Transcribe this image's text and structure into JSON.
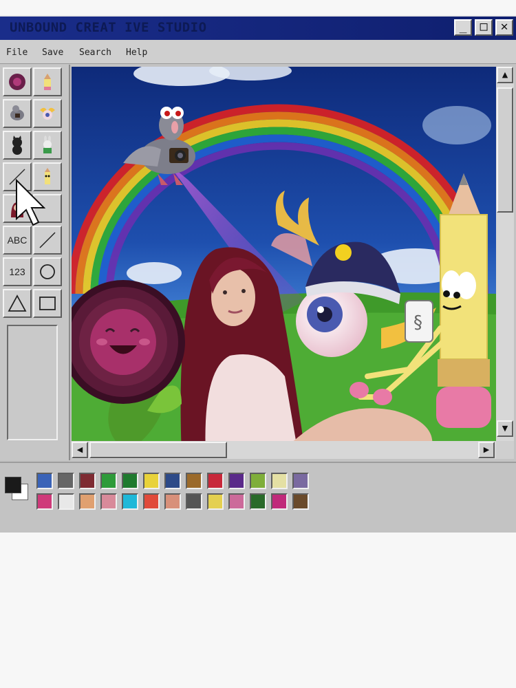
{
  "window": {
    "title": "UNBOUND CREAT IVE STUDIO",
    "controls": {
      "minimize": "_",
      "maximize": "□",
      "close": "✕"
    }
  },
  "menu": [
    "File",
    "Save",
    "Search",
    "Help"
  ],
  "tools": [
    {
      "name": "flower-stamp-tool",
      "label": "",
      "icon": "flower-icon"
    },
    {
      "name": "pencil-stamp-tool",
      "label": "",
      "icon": "pencil-icon"
    },
    {
      "name": "pigeon-camera-tool",
      "label": "",
      "icon": "pigeon-icon"
    },
    {
      "name": "winged-eye-tool",
      "label": "",
      "icon": "winged-eye-icon"
    },
    {
      "name": "black-cat-tool",
      "label": "",
      "icon": "cat-icon"
    },
    {
      "name": "bunny-tool",
      "label": "",
      "icon": "bunny-icon"
    },
    {
      "name": "line-tool",
      "label": "",
      "icon": "line-icon"
    },
    {
      "name": "pencil-character-tool",
      "label": "",
      "icon": "pencil-character-icon"
    },
    {
      "name": "girl-stamp-tool",
      "label": "",
      "icon": "portrait-icon"
    },
    {
      "name": "empty-tool",
      "label": "",
      "icon": ""
    },
    {
      "name": "text-tool",
      "label": "ABC",
      "icon": "text-icon"
    },
    {
      "name": "diagonal-line-tool",
      "label": "",
      "icon": "line-icon"
    },
    {
      "name": "number-tool",
      "label": "123",
      "icon": "number-icon"
    },
    {
      "name": "circle-tool",
      "label": "",
      "icon": "circle-icon"
    },
    {
      "name": "triangle-tool",
      "label": "",
      "icon": "triangle-icon"
    },
    {
      "name": "rectangle-tool",
      "label": "",
      "icon": "rectangle-icon"
    }
  ],
  "colors": {
    "foreground": "#1a1a1a",
    "background": "#ffffff",
    "row1": [
      "#3a63b8",
      "#666666",
      "#7e2b32",
      "#2e9b3a",
      "#1f7a2e",
      "#e8d23a",
      "#2d4a88",
      "#9b6a2a",
      "#c8283a",
      "#5a2a8a",
      "#7fae3a",
      "#e4e0a4",
      "#7a6aa0"
    ],
    "row2": [
      "#cf3a7a",
      "#e8e8e8",
      "#e0a070",
      "#d88a9a",
      "#1fb8d8",
      "#e04a3a",
      "#d8907a",
      "#555555",
      "#e4d050",
      "#cc6a9a",
      "#2a6a2a",
      "#c02a7a",
      "#6a4a2a"
    ]
  }
}
